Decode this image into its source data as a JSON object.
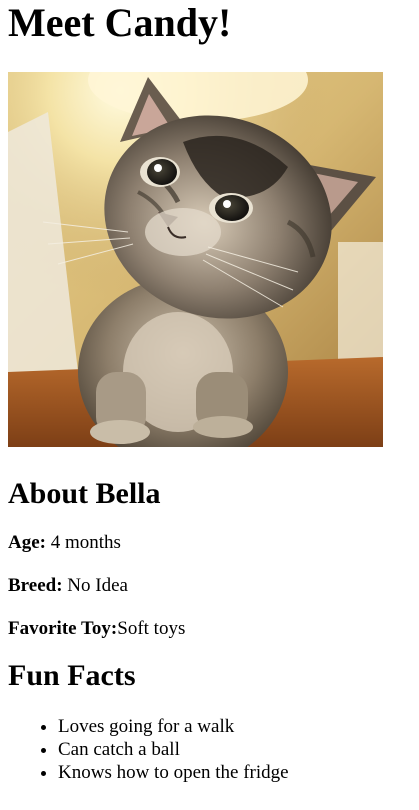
{
  "page": {
    "title": "Meet Candy!"
  },
  "photo": {
    "alt": "kitten photo"
  },
  "about": {
    "heading": "About Bella",
    "age_label": "Age:",
    "age_value": " 4 months",
    "breed_label": "Breed:",
    "breed_value": " No Idea",
    "toy_label": "Favorite Toy:",
    "toy_value": "Soft toys"
  },
  "fun_facts": {
    "heading": "Fun Facts",
    "items": [
      "Loves going for a walk",
      "Can catch a ball",
      "Knows how to open the fridge"
    ]
  }
}
